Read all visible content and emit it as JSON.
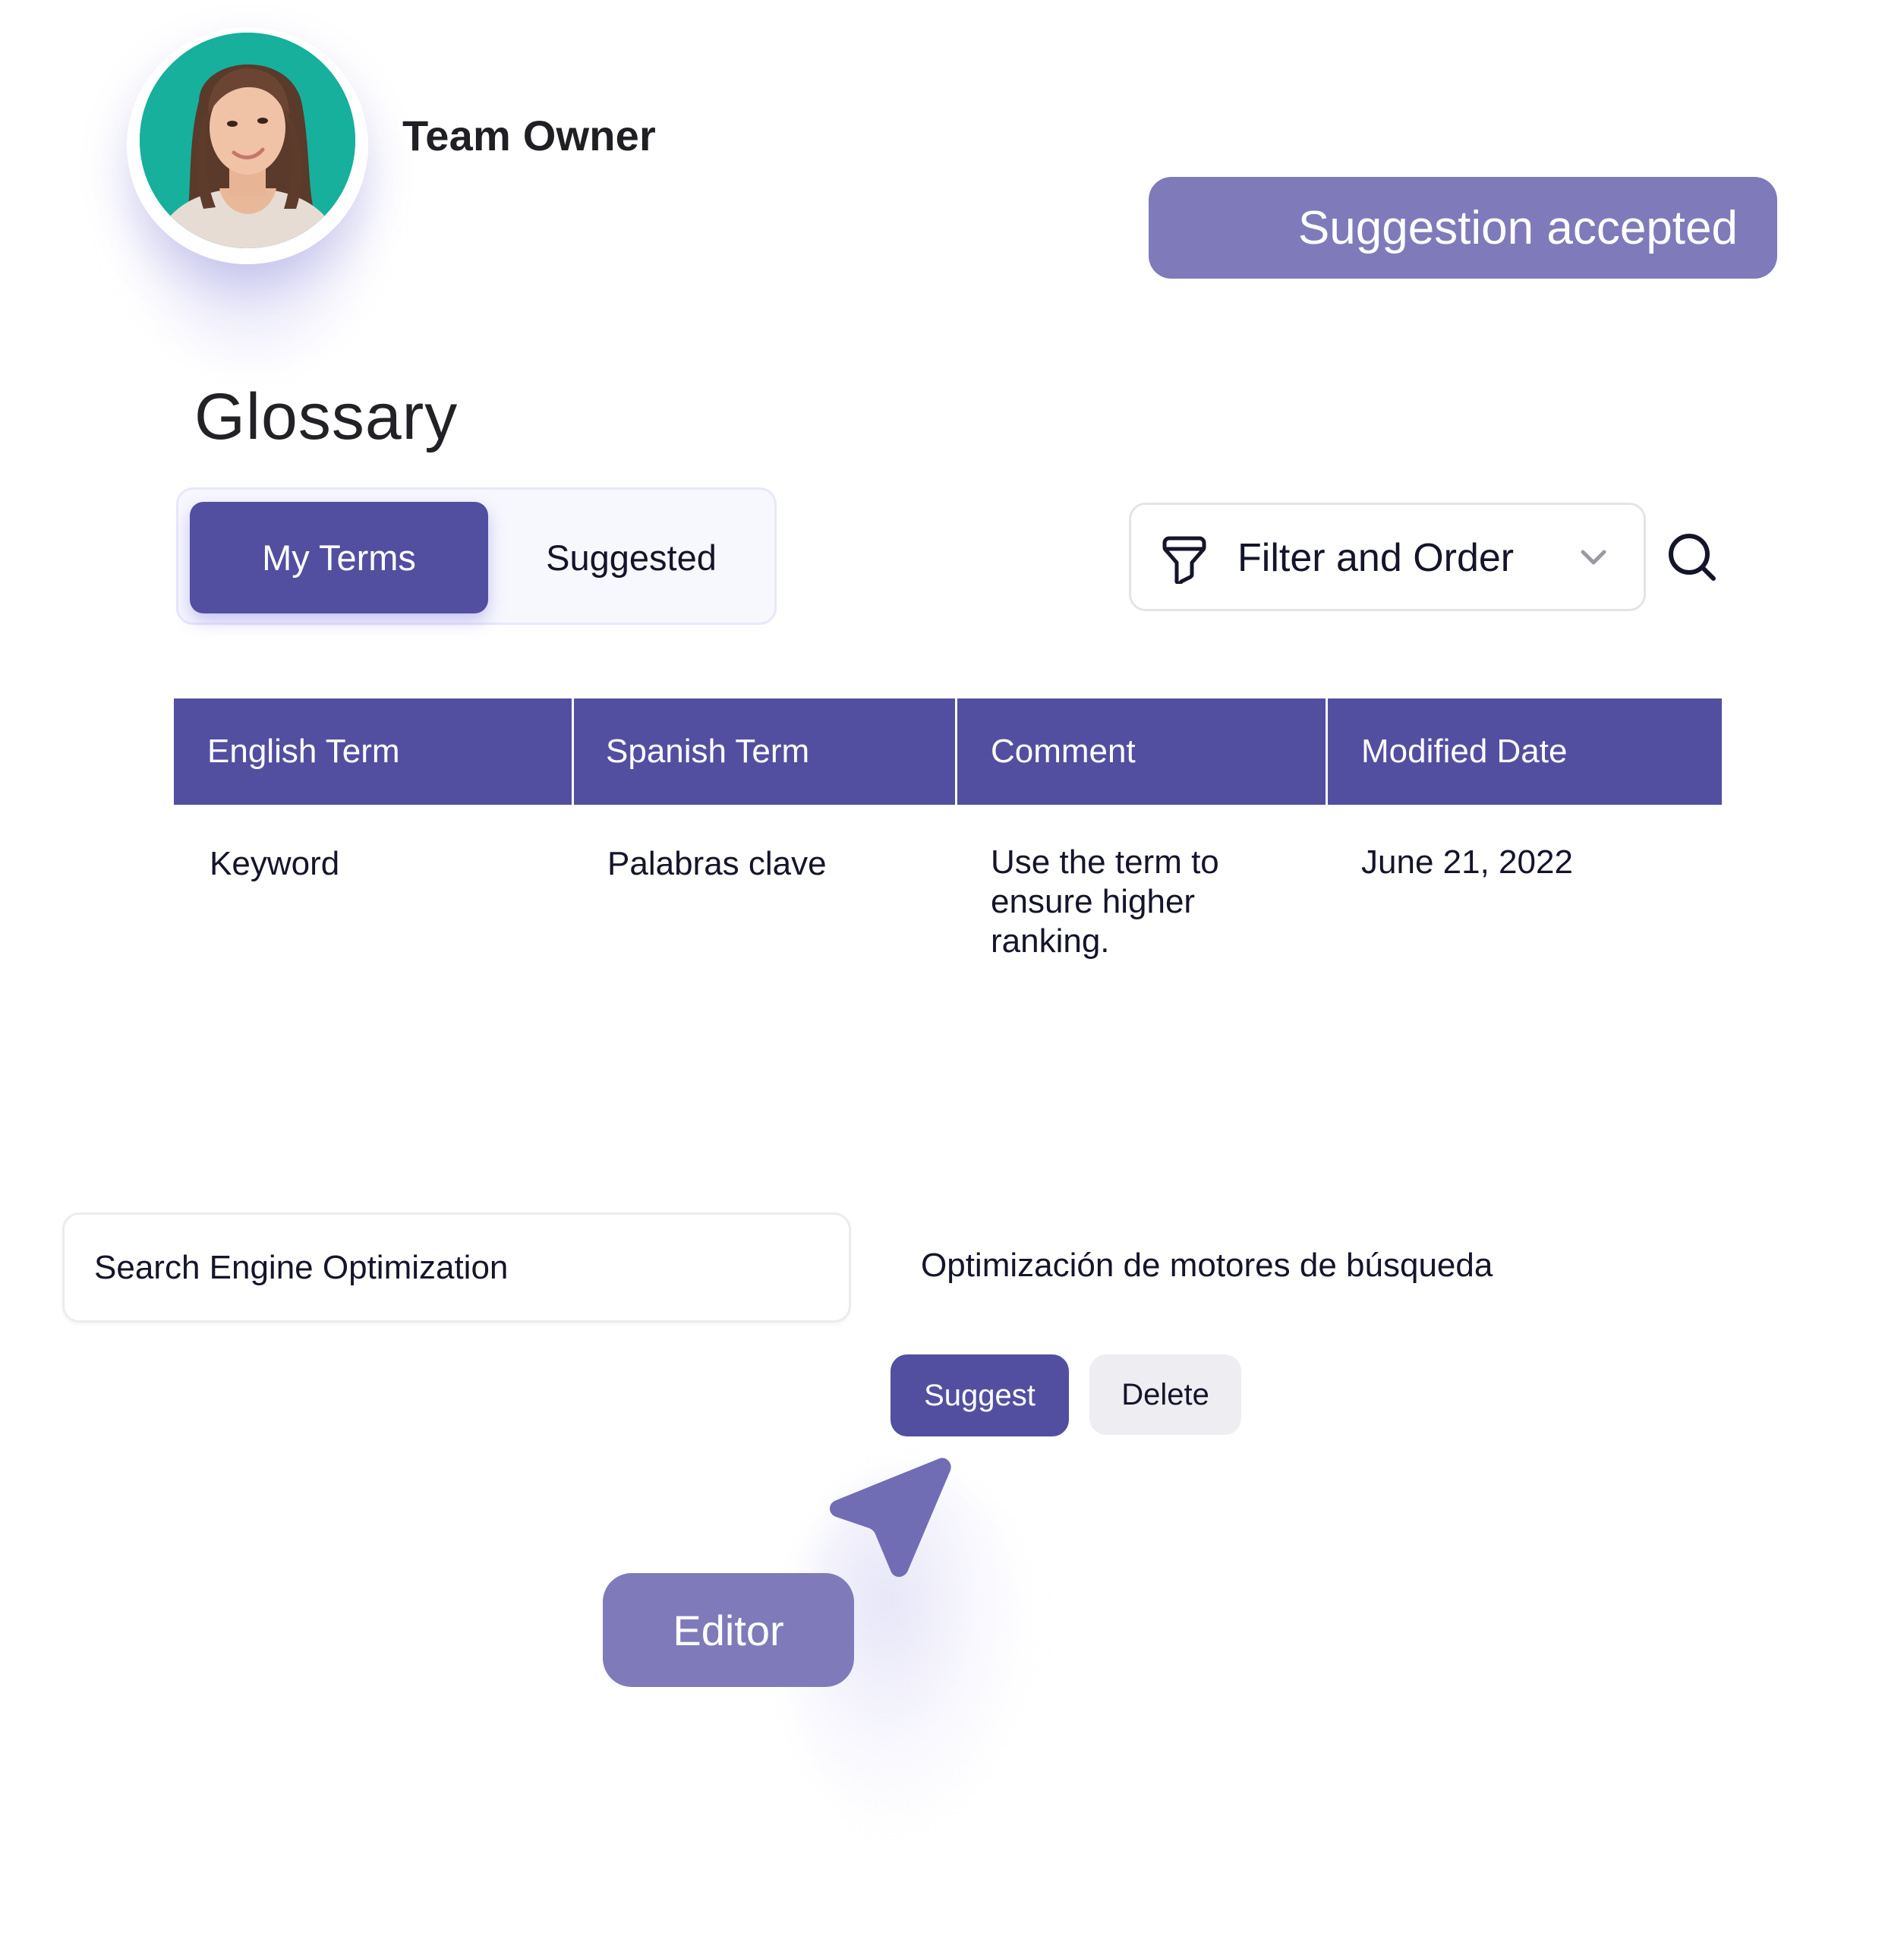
{
  "user": {
    "role_label": "Team Owner",
    "avatar_icon": "user-avatar-photo",
    "avatar_bg_color": "#16B09C"
  },
  "notification": {
    "badge_label": "Suggestion accepted",
    "color": "#7F7BBA"
  },
  "page": {
    "title": "Glossary"
  },
  "tabs": [
    {
      "label": "My Terms",
      "active": true
    },
    {
      "label": "Suggested",
      "active": false
    }
  ],
  "toolbar": {
    "filter_icon": "filter-funnel-icon",
    "filter_label": "Filter and Order",
    "dropdown_icon": "chevron-down-icon",
    "search_icon": "search-icon"
  },
  "table": {
    "header_color": "#524FA1",
    "columns": [
      "English Term",
      "Spanish Term",
      "Comment",
      "Modified Date"
    ],
    "rows": [
      {
        "english": "Keyword",
        "spanish": "Palabras clave",
        "comment": "Use the term to ensure higher ranking.",
        "modified": "June 21, 2022"
      }
    ]
  },
  "new_term": {
    "english_value": "Search Engine Optimization",
    "spanish_value": "Optimización de motores de búsqueda",
    "suggest_label": "Suggest",
    "delete_label": "Delete"
  },
  "collaborator": {
    "cursor_icon": "pointer-cursor-icon",
    "label": "Editor",
    "color": "#7F7BBA"
  },
  "colors": {
    "primary": "#524FA1",
    "accent_soft": "#7F7BBA",
    "text": "#14142B",
    "tab_bg": "#F7F7FE",
    "muted_button": "#EEEEF2"
  }
}
